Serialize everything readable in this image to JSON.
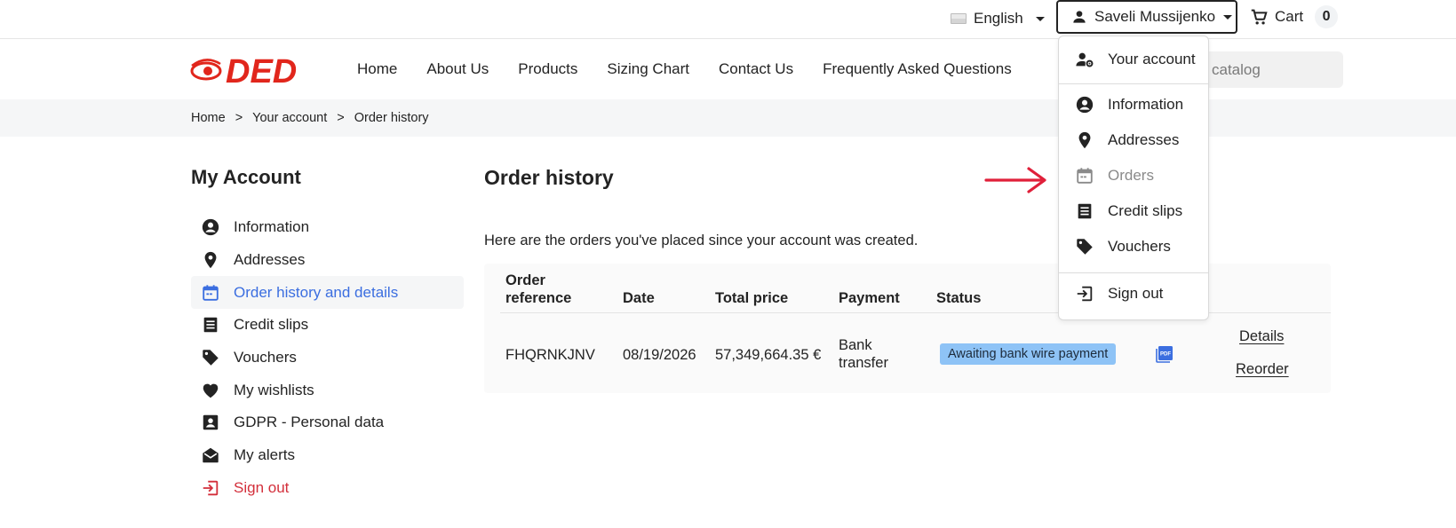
{
  "topbar": {
    "language": "English",
    "user_name": "Saveli Mussijenko",
    "cart_label": "Cart",
    "cart_count": "0"
  },
  "header": {
    "logo_text": "DED",
    "nav": [
      "Home",
      "About Us",
      "Products",
      "Sizing Chart",
      "Contact Us",
      "Frequently Asked Questions"
    ],
    "search_placeholder": "catalog"
  },
  "breadcrumb": {
    "items": [
      "Home",
      "Your account",
      "Order history"
    ],
    "separator": ">"
  },
  "sidebar": {
    "title": "My Account",
    "items": [
      {
        "label": "Information",
        "icon": "account-circle-icon"
      },
      {
        "label": "Addresses",
        "icon": "location-pin-icon"
      },
      {
        "label": "Order history and details",
        "icon": "calendar-icon"
      },
      {
        "label": "Credit slips",
        "icon": "receipt-icon"
      },
      {
        "label": "Vouchers",
        "icon": "tag-icon"
      },
      {
        "label": "My wishlists",
        "icon": "heart-icon"
      },
      {
        "label": "GDPR - Personal data",
        "icon": "contact-card-icon"
      },
      {
        "label": "My alerts",
        "icon": "open-envelope-icon"
      },
      {
        "label": "Sign out",
        "icon": "sign-out-icon"
      }
    ]
  },
  "main": {
    "title": "Order history",
    "intro": "Here are the orders you've placed since your account was created.",
    "table": {
      "headers": {
        "reference": "Order reference",
        "reference_l1": "Order",
        "reference_l2": "reference",
        "date": "Date",
        "total": "Total price",
        "payment": "Payment",
        "status": "Status"
      },
      "rows": [
        {
          "reference": "FHQRNKJNV",
          "date": "08/19/2026",
          "total": "57,349,664.35 €",
          "payment_l1": "Bank",
          "payment_l2": "transfer",
          "status": "Awaiting bank wire payment",
          "details": "Details",
          "reorder": "Reorder"
        }
      ]
    }
  },
  "dropdown": {
    "your_account": "Your account",
    "items": [
      "Information",
      "Addresses",
      "Orders",
      "Credit slips",
      "Vouchers"
    ],
    "sign_out": "Sign out"
  },
  "colors": {
    "accent_blue": "#3b6ee0",
    "danger_red": "#d32f3b",
    "badge_blue": "#8ec3f6",
    "logo_red": "#e1261c",
    "arrow_red": "#e0203a"
  }
}
